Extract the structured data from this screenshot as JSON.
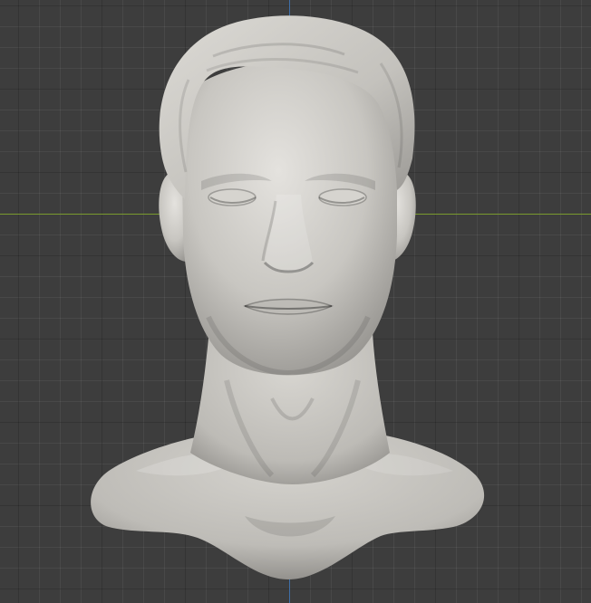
{
  "viewport": {
    "kind": "3d-viewport",
    "grid": "on",
    "axes": [
      "x-axis-line",
      "y-axis-line"
    ],
    "colors": {
      "background": "#3d3d3d",
      "grid_minor": "#454545",
      "grid_major": "#2f2f2f",
      "x_axis": "#7a9a2e",
      "y_axis": "#3f6fa8",
      "clay": "#c9c7c2"
    }
  },
  "model": {
    "subject": "sculpted-head-bust",
    "material": "clay"
  }
}
